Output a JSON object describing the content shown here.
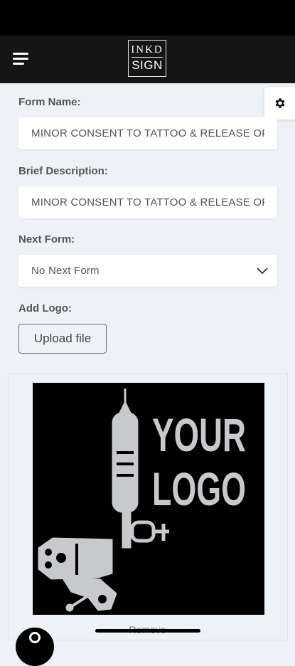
{
  "header": {
    "brand_top": "INKD",
    "brand_bottom": "SIGN"
  },
  "form": {
    "form_name_label": "Form Name:",
    "form_name_value": "MINOR CONSENT TO TATTOO & RELEASE OF",
    "description_label": "Brief Description:",
    "description_value": "MINOR CONSENT TO TATTOO & RELEASE OF",
    "next_form_label": "Next Form:",
    "next_form_value": "No Next Form",
    "add_logo_label": "Add Logo:",
    "upload_label": "Upload file"
  },
  "logo_preview": {
    "line1": "YOUR",
    "line2": "LOGO",
    "remove_label": "Remove"
  },
  "colors": {
    "header_bg": "#151515",
    "page_bg": "#eef1f5"
  },
  "icons": [
    "menu-icon",
    "gear-icon",
    "chevron-down-icon"
  ]
}
